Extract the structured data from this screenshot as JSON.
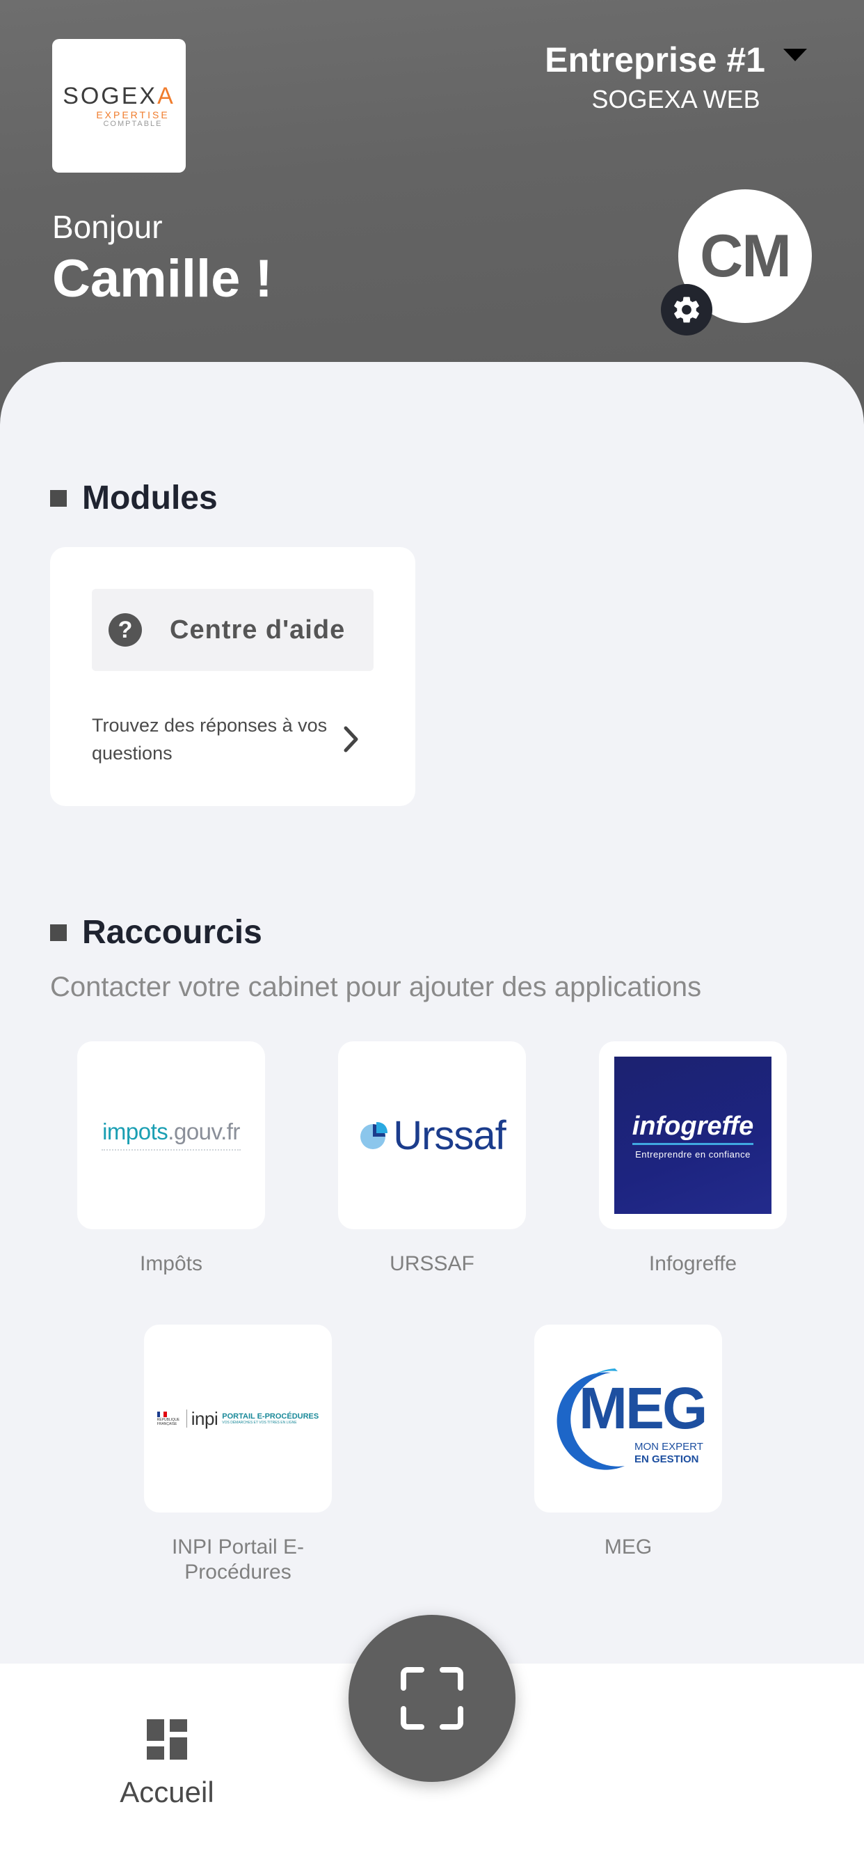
{
  "header": {
    "logo": {
      "text_main_pre": "SOGEX",
      "text_main_accent": "A",
      "text_sub": "EXPERTISE",
      "text_sub2": "COMPTABLE"
    },
    "company_name": "Entreprise #1",
    "company_sub": "SOGEXA WEB",
    "greeting": "Bonjour",
    "username": "Camille !",
    "avatar_initials": "CM"
  },
  "modules": {
    "title": "Modules",
    "help_center": {
      "label": "Centre d'aide",
      "icon": "?",
      "description": "Trouvez des réponses à vos questions"
    }
  },
  "shortcuts": {
    "title": "Raccourcis",
    "subtitle": "Contacter votre cabinet pour ajouter des applications",
    "items": [
      {
        "label": "Impôts",
        "logo_text": "impots.gouv.fr",
        "logo_pre": "impots",
        "logo_post": ".gouv.fr"
      },
      {
        "label": "URSSAF",
        "logo_text": "Urssaf"
      },
      {
        "label": "Infogreffe",
        "logo_text": "infogreffe",
        "logo_tagline": "Entreprendre en confiance"
      },
      {
        "label": "INPI Portail E-Procédures",
        "logo_text": "inpi",
        "logo_tagline": "PORTAIL E-PROCÉDURES",
        "logo_small": "VOS DÉMARCHES ET VOS TITRES EN LIGNE",
        "logo_rf": "RÉPUBLIQUE FRANÇAISE"
      },
      {
        "label": "MEG",
        "logo_text": "MEG",
        "logo_tagline1": "MON EXPERT",
        "logo_tagline2": "EN GESTION"
      }
    ]
  },
  "bottom_nav": {
    "home_label": "Accueil"
  },
  "colors": {
    "header_bg": "#646464",
    "accent_orange": "#f07c2c",
    "background": "#f2f3f7",
    "urssaf_blue": "#1b3c8c",
    "infogreffe_bg": "#1c2270",
    "meg_blue": "#1d66c8"
  }
}
